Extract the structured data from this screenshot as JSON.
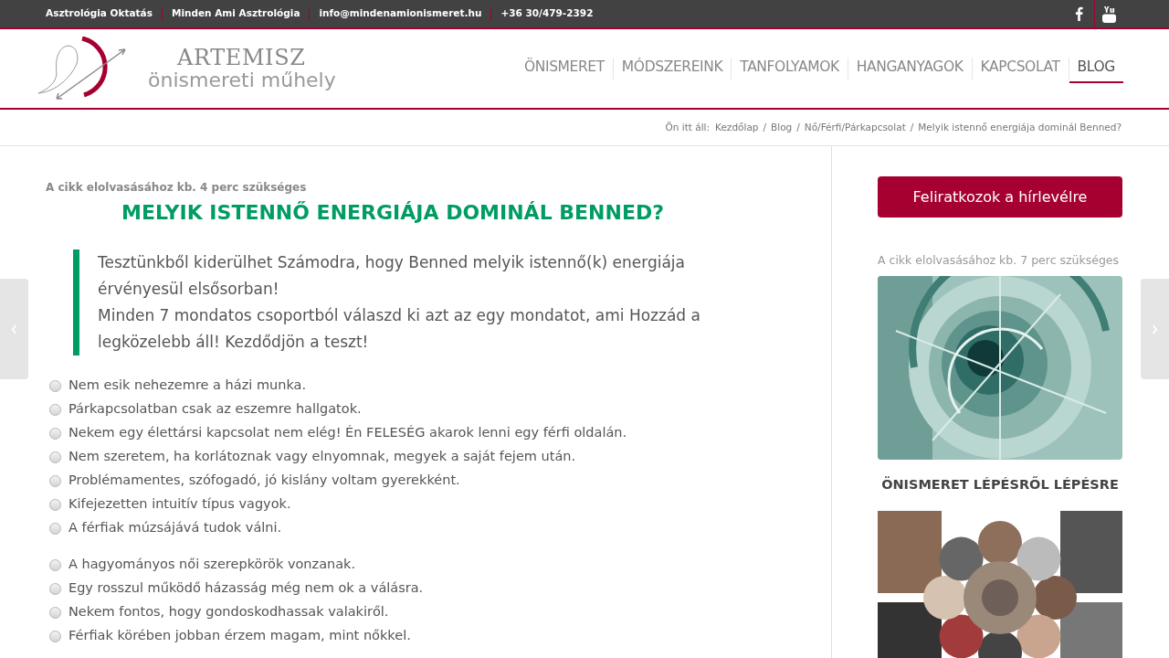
{
  "top_bar": {
    "links": [
      "Asztrológia Oktatás",
      "Minden Ami Asztrológia",
      "info@mindenamionismeret.hu",
      "+36 30/479-2392"
    ]
  },
  "logo": {
    "title": "ARTEMISZ",
    "subtitle": "önismereti műhely"
  },
  "nav": [
    {
      "label": "ÖNISMERET",
      "selected": false
    },
    {
      "label": "MÓDSZEREINK",
      "selected": false
    },
    {
      "label": "TANFOLYAMOK",
      "selected": false
    },
    {
      "label": "HANGANYAGOK",
      "selected": false
    },
    {
      "label": "KAPCSOLAT",
      "selected": false
    },
    {
      "label": "BLOG",
      "selected": true
    }
  ],
  "breadcrumb": {
    "prefix": "Ön itt áll:",
    "separator": "/",
    "items": [
      "Kezdőlap",
      "Blog",
      "Nő/Férfi/Párkapcsolat",
      "Melyik istennő energiája dominál Benned?"
    ]
  },
  "article": {
    "reading_time": "A cikk elolvasásához kb. 4 perc szükséges",
    "title": "MELYIK ISTENNŐ ENERGIÁJA DOMINÁL BENNED?",
    "quote": [
      "Tesztünkből kiderülhet Számodra, hogy Benned melyik istennő(k) energiája érvényesül elsősorban!",
      "Minden 7 mondatos csoportból válaszd ki azt az egy mondatot, ami Hozzád a legközelebb áll! Kezdődjön a teszt!"
    ],
    "groups": [
      {
        "options": [
          {
            "label": "Nem esik nehezemre a házi munka.",
            "checked": false
          },
          {
            "label": "Párkapcsolatban csak az eszemre hallgatok.",
            "checked": false
          },
          {
            "label": "Nekem egy élettársi kapcsolat nem elég! Én FELESÉG akarok lenni egy férfi oldalán.",
            "checked": false
          },
          {
            "label": "Nem szeretem, ha korlátoznak vagy elnyomnak, megyek a saját fejem után.",
            "checked": false
          },
          {
            "label": "Problémamentes, szófogadó, jó kislány voltam gyerekként.",
            "checked": false
          },
          {
            "label": "Kifejezetten intuitív típus vagyok.",
            "checked": false
          },
          {
            "label": "A férfiak múzsájává tudok válni.",
            "checked": false
          }
        ]
      },
      {
        "options": [
          {
            "label": "A hagyományos női szerepkörök vonzanak.",
            "checked": false
          },
          {
            "label": "Egy rosszul működő házasság még nem ok a válásra.",
            "checked": false
          },
          {
            "label": "Nekem fontos, hogy gondoskodhassak valakiről.",
            "checked": false
          },
          {
            "label": "Férfiak körében jobban érzem magam, mint nőkkel.",
            "checked": false
          }
        ]
      }
    ]
  },
  "sidebar": {
    "button": "Feliratkozok a hírlevélre",
    "reading_time": "A cikk elolvasásához kb. 7 perc szükséges",
    "heading": "ÖNISMERET LÉPÉSRŐL LÉPÉSRE"
  }
}
